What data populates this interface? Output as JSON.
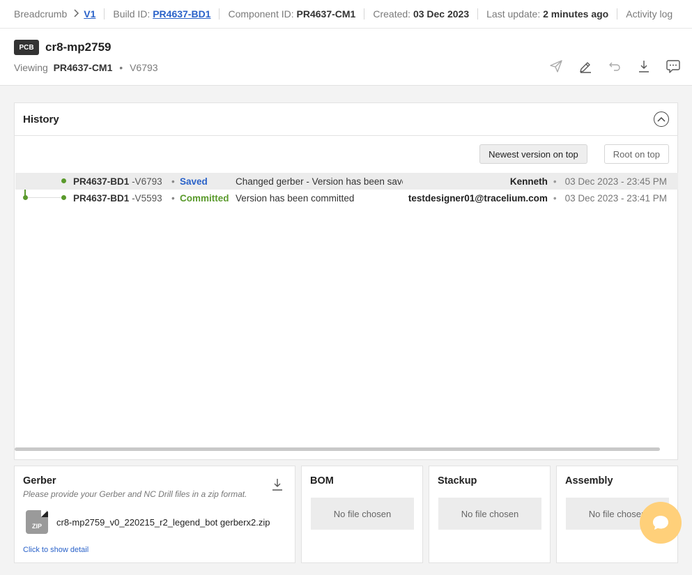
{
  "topbar": {
    "breadcrumb_label": "Breadcrumb",
    "version_link": "V1",
    "build_label": "Build ID:",
    "build_id": "PR4637-BD1",
    "component_label": "Component ID:",
    "component_id": "PR4637-CM1",
    "created_label": "Created:",
    "created_value": "03 Dec 2023",
    "update_label": "Last update:",
    "update_value": "2 minutes ago",
    "activity_log": "Activity log"
  },
  "header": {
    "badge": "PCB",
    "title": "cr8-mp2759",
    "viewing_label": "Viewing",
    "viewing_component": "PR4637-CM1",
    "viewing_version": "V6793",
    "action_icons": [
      "send-icon",
      "edit-icon",
      "undo-icon",
      "download-icon",
      "comment-icon"
    ]
  },
  "history": {
    "title": "History",
    "sort_newest": "Newest version on top",
    "sort_root": "Root on top",
    "rows": [
      {
        "id": "PR4637-BD1",
        "version": "-V6793",
        "status": "Saved",
        "message": "Changed gerber - Version has been saved",
        "user": "Kenneth",
        "datetime": "03 Dec 2023 - 23:45 PM"
      },
      {
        "id": "PR4637-BD1",
        "version": "-V5593",
        "status": "Committed",
        "message": "Version has been committed",
        "user": "testdesigner01@tracelium.com",
        "datetime": "03 Dec 2023 - 23:41 PM"
      }
    ]
  },
  "files": {
    "gerber": {
      "title": "Gerber",
      "subtitle": "Please provide your Gerber and NC Drill files in a zip format.",
      "zip_label": "ZIP",
      "filename": "cr8-mp2759_v0_220215_r2_legend_bot gerberx2.zip",
      "show_detail": "Click to show detail"
    },
    "bom": {
      "title": "BOM",
      "placeholder": "No file chosen"
    },
    "stackup": {
      "title": "Stackup",
      "placeholder": "No file chosen"
    },
    "assembly": {
      "title": "Assembly",
      "placeholder": "No file chosen"
    }
  },
  "colors": {
    "link": "#2a62c9",
    "saved": "#2a62c9",
    "committed": "#5a9a2c",
    "chat_bubble": "#ffd07a"
  }
}
